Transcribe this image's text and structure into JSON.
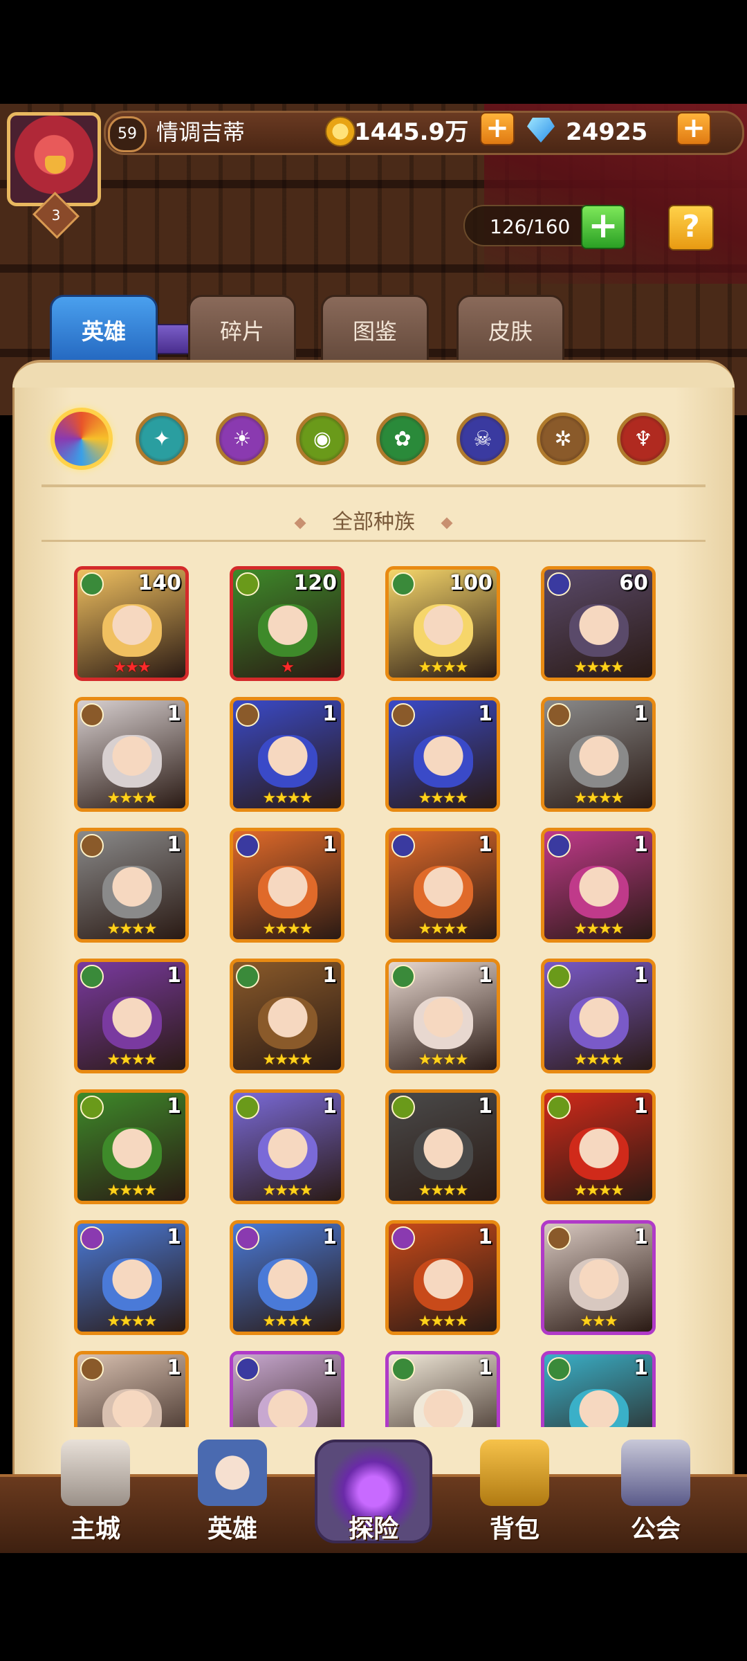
{
  "player": {
    "level": "59",
    "name": "情调吉蒂",
    "vip_rank": "3",
    "gold": "1445.9万",
    "diamonds": "24925"
  },
  "hero_capacity": "126/160",
  "tabs": [
    {
      "label": "英雄",
      "active": true
    },
    {
      "label": "碎片",
      "active": false
    },
    {
      "label": "图鉴",
      "active": false
    },
    {
      "label": "皮肤",
      "active": false
    }
  ],
  "factions": [
    {
      "icon": "all-factions-icon",
      "active": true,
      "color": "#e8542a"
    },
    {
      "icon": "wings-faction-icon",
      "active": false,
      "color": "#2a9ea0"
    },
    {
      "icon": "flame-faction-icon",
      "active": false,
      "color": "#8a3ab0"
    },
    {
      "icon": "eye-faction-icon",
      "active": false,
      "color": "#6a9a1a"
    },
    {
      "icon": "leaf-faction-icon",
      "active": false,
      "color": "#2a8a3a"
    },
    {
      "icon": "skull-faction-icon",
      "active": false,
      "color": "#3a3aa0"
    },
    {
      "icon": "sun-faction-icon",
      "active": false,
      "color": "#8a5a2a"
    },
    {
      "icon": "demon-faction-icon",
      "active": false,
      "color": "#b02a20"
    }
  ],
  "section_title": "全部种族",
  "heroes": [
    {
      "level": "140",
      "stars": 3,
      "star_color": "red",
      "frame": "red",
      "element": "#3a8a3a",
      "tone": "#f0c060"
    },
    {
      "level": "120",
      "stars": 1,
      "star_color": "red",
      "frame": "red",
      "element": "#6a9a1a",
      "tone": "#3e8a2a"
    },
    {
      "level": "100",
      "stars": 4,
      "star_color": "gold",
      "frame": "orange",
      "element": "#3a8a3a",
      "tone": "#f6d66a"
    },
    {
      "level": "60",
      "stars": 4,
      "star_color": "gold",
      "frame": "orange",
      "element": "#3a3aa0",
      "tone": "#5a4a6a"
    },
    {
      "level": "1",
      "stars": 4,
      "star_color": "gold",
      "frame": "orange",
      "element": "#8a5a2a",
      "tone": "#d8d0d0"
    },
    {
      "level": "1",
      "stars": 4,
      "star_color": "gold",
      "frame": "orange",
      "element": "#8a5a2a",
      "tone": "#3a4ac8"
    },
    {
      "level": "1",
      "stars": 4,
      "star_color": "gold",
      "frame": "orange",
      "element": "#8a5a2a",
      "tone": "#3a4ac8"
    },
    {
      "level": "1",
      "stars": 4,
      "star_color": "gold",
      "frame": "orange",
      "element": "#8a5a2a",
      "tone": "#8a8a8a"
    },
    {
      "level": "1",
      "stars": 4,
      "star_color": "gold",
      "frame": "orange",
      "element": "#8a5a2a",
      "tone": "#8a8a8a"
    },
    {
      "level": "1",
      "stars": 4,
      "star_color": "gold",
      "frame": "orange",
      "element": "#3a3aa0",
      "tone": "#e06a2a"
    },
    {
      "level": "1",
      "stars": 4,
      "star_color": "gold",
      "frame": "orange",
      "element": "#3a3aa0",
      "tone": "#e06a2a"
    },
    {
      "level": "1",
      "stars": 4,
      "star_color": "gold",
      "frame": "orange",
      "element": "#3a3aa0",
      "tone": "#c03a8a"
    },
    {
      "level": "1",
      "stars": 4,
      "star_color": "gold",
      "frame": "orange",
      "element": "#3a8a3a",
      "tone": "#7a3aa0"
    },
    {
      "level": "1",
      "stars": 4,
      "star_color": "gold",
      "frame": "orange",
      "element": "#3a8a3a",
      "tone": "#8a5a2a"
    },
    {
      "level": "1",
      "stars": 4,
      "star_color": "gold",
      "frame": "orange",
      "element": "#3a8a3a",
      "tone": "#e8d8d0"
    },
    {
      "level": "1",
      "stars": 4,
      "star_color": "gold",
      "frame": "orange",
      "element": "#6a9a1a",
      "tone": "#7a5ac8"
    },
    {
      "level": "1",
      "stars": 4,
      "star_color": "gold",
      "frame": "orange",
      "element": "#6a9a1a",
      "tone": "#3e8a2a"
    },
    {
      "level": "1",
      "stars": 4,
      "star_color": "gold",
      "frame": "orange",
      "element": "#6a9a1a",
      "tone": "#7a6ad8"
    },
    {
      "level": "1",
      "stars": 4,
      "star_color": "gold",
      "frame": "orange",
      "element": "#6a9a1a",
      "tone": "#4a4a4a"
    },
    {
      "level": "1",
      "stars": 4,
      "star_color": "gold",
      "frame": "orange",
      "element": "#6a9a1a",
      "tone": "#d02a1a"
    },
    {
      "level": "1",
      "stars": 4,
      "star_color": "gold",
      "frame": "orange",
      "element": "#8a3ab0",
      "tone": "#4a7ad8"
    },
    {
      "level": "1",
      "stars": 4,
      "star_color": "gold",
      "frame": "orange",
      "element": "#8a3ab0",
      "tone": "#4a7ad8"
    },
    {
      "level": "1",
      "stars": 4,
      "star_color": "gold",
      "frame": "orange",
      "element": "#8a3ab0",
      "tone": "#c84a1a"
    },
    {
      "level": "1",
      "stars": 3,
      "star_color": "gold",
      "frame": "purple",
      "element": "#8a5a2a",
      "tone": "#d8c8c0"
    },
    {
      "level": "1",
      "stars": 0,
      "star_color": "gold",
      "frame": "orange",
      "element": "#8a5a2a",
      "tone": "#d8c0b0"
    },
    {
      "level": "1",
      "stars": 0,
      "star_color": "gold",
      "frame": "purple",
      "element": "#3a3aa0",
      "tone": "#c8a8d0"
    },
    {
      "level": "1",
      "stars": 0,
      "star_color": "gold",
      "frame": "purple",
      "element": "#3a8a3a",
      "tone": "#f0e8d8"
    },
    {
      "level": "1",
      "stars": 0,
      "star_color": "gold",
      "frame": "purple",
      "element": "#3a8a3a",
      "tone": "#3ab0c8"
    }
  ],
  "nav": [
    {
      "label": "主城",
      "icon": "castle-icon"
    },
    {
      "label": "英雄",
      "icon": "hero-icon"
    },
    {
      "label": "探险",
      "icon": "portal-icon"
    },
    {
      "label": "背包",
      "icon": "backpack-icon"
    },
    {
      "label": "公会",
      "icon": "guild-icon"
    }
  ]
}
